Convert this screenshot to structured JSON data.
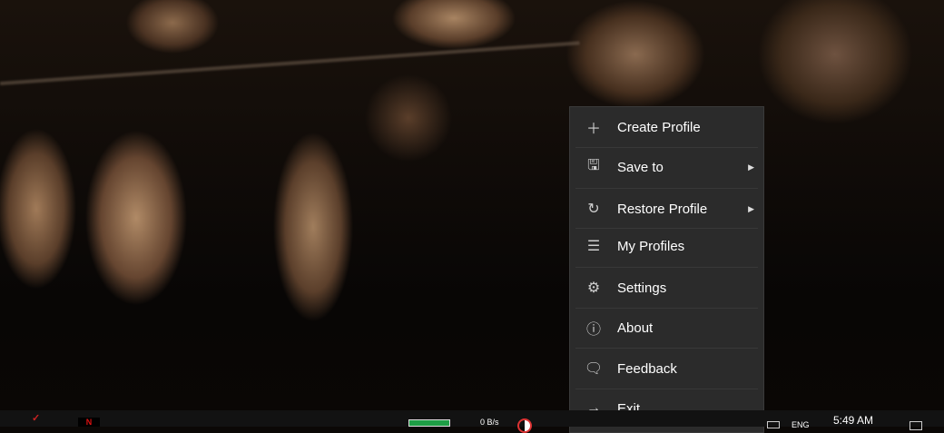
{
  "menu": {
    "items": [
      {
        "label": "Create Profile",
        "icon": "plus-icon",
        "submenu": false
      },
      {
        "label": "Save to",
        "icon": "save-icon",
        "submenu": true
      },
      {
        "label": "Restore Profile",
        "icon": "restore-icon",
        "submenu": true
      },
      {
        "label": "My Profiles",
        "icon": "list-icon",
        "submenu": false
      },
      {
        "label": "Settings",
        "icon": "gear-icon",
        "submenu": false
      },
      {
        "label": "About",
        "icon": "info-icon",
        "submenu": false
      },
      {
        "label": "Feedback",
        "icon": "feedback-icon",
        "submenu": false
      },
      {
        "label": "Exit",
        "icon": "arrow-right-icon",
        "submenu": false
      }
    ]
  },
  "taskbar": {
    "net_speed": "0 B/s",
    "language": "ENG",
    "time": "5:49 AM"
  }
}
